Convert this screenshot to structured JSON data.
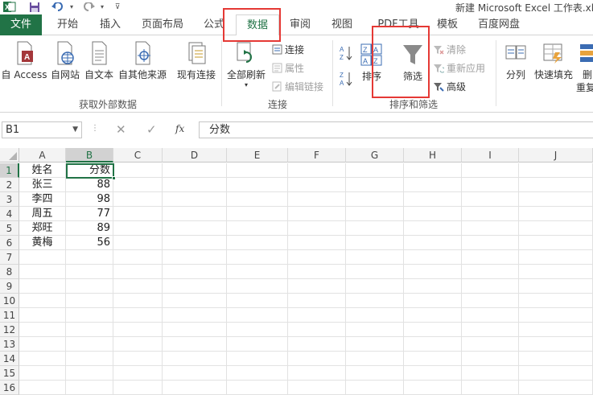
{
  "window": {
    "title": "新建 Microsoft Excel 工作表.xls"
  },
  "qat": {
    "app_icon": "excel-logo-icon",
    "save_icon": "save-icon",
    "undo_icon": "undo-icon",
    "redo_icon": "redo-icon",
    "customize_icon": "customize-qat-icon"
  },
  "tabs": {
    "file": "文件",
    "home": "开始",
    "insert": "插入",
    "layout": "页面布局",
    "formulas": "公式",
    "data": "数据",
    "review": "审阅",
    "view": "视图",
    "pdf": "PDF工具",
    "template": "模板",
    "baidu": "百度网盘"
  },
  "ribbon": {
    "external": {
      "access": "自 Access",
      "web": "自网站",
      "text": "自文本",
      "other": "自其他来源",
      "existing": "现有连接",
      "group": "获取外部数据"
    },
    "connections": {
      "refresh_all": "全部刷新",
      "connections": "连接",
      "properties": "属性",
      "edit_links": "编辑链接",
      "group": "连接"
    },
    "sort_filter": {
      "sort": "排序",
      "filter": "筛选",
      "clear": "清除",
      "reapply": "重新应用",
      "advanced": "高级",
      "group": "排序和筛选"
    },
    "tools": {
      "split": "分列",
      "flash_fill": "快速填充",
      "remove_dup_1": "删",
      "remove_dup_2": "重复"
    }
  },
  "formula_bar": {
    "name_box": "B1",
    "content": "分数",
    "cancel": "✕",
    "enter": "✓",
    "fx": "fx"
  },
  "columns": [
    "A",
    "B",
    "C",
    "D",
    "E",
    "F",
    "G",
    "H",
    "I",
    "J"
  ],
  "rows": [
    "1",
    "2",
    "3",
    "4",
    "5",
    "6",
    "7",
    "8",
    "9",
    "10",
    "11",
    "12",
    "13",
    "14",
    "15",
    "16"
  ],
  "cells": {
    "a": [
      "姓名",
      "张三",
      "李四",
      "周五",
      "郑旺",
      "黄梅"
    ],
    "b": [
      "分数",
      "88",
      "98",
      "77",
      "89",
      "56"
    ]
  },
  "colors": {
    "excel_green": "#217346",
    "highlight_red": "#e53935"
  }
}
